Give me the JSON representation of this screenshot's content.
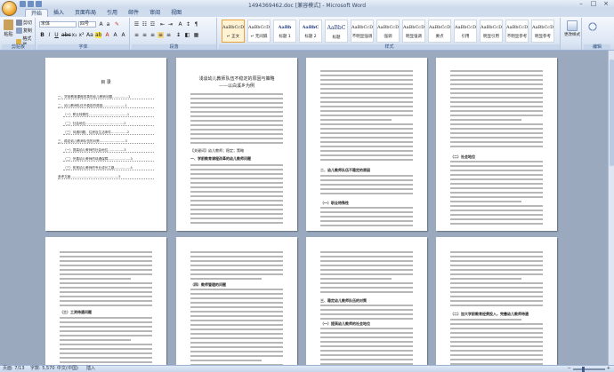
{
  "window": {
    "title": "1494369462.doc [兼容模式] - Microsoft Word"
  },
  "tabs": [
    "开始",
    "插入",
    "页面布局",
    "引用",
    "邮件",
    "审阅",
    "视图"
  ],
  "active_tab": "开始",
  "clipboard": {
    "paste": "粘贴",
    "cut": "剪切",
    "copy": "复制",
    "format_painter": "格式刷",
    "label": "剪贴板"
  },
  "font": {
    "name": "宋体",
    "size": "四号",
    "label": "字体"
  },
  "paragraph": {
    "label": "段落"
  },
  "styles": {
    "label": "样式",
    "items": [
      {
        "sample": "AaBbCcDc",
        "name": "↵ 正文",
        "selected": true
      },
      {
        "sample": "AaBbCcDc",
        "name": "↵ 无间隔",
        "selected": false
      },
      {
        "sample": "AaBb",
        "name": "标题 1",
        "selected": false
      },
      {
        "sample": "AaBbC",
        "name": "标题 2",
        "selected": false
      },
      {
        "sample": "AaBbC",
        "name": "标题",
        "selected": false
      },
      {
        "sample": "AaBbCcD",
        "name": "不明显强调",
        "selected": false
      },
      {
        "sample": "AaBbCcDc",
        "name": "强调",
        "selected": false
      },
      {
        "sample": "AaBbCcDc",
        "name": "明显强调",
        "selected": false
      },
      {
        "sample": "AaBbCcDc",
        "name": "要点",
        "selected": false
      },
      {
        "sample": "AaBbCcDc",
        "name": "引用",
        "selected": false
      },
      {
        "sample": "AaBbCcDc",
        "name": "明显引用",
        "selected": false
      },
      {
        "sample": "AaBbCcDc",
        "name": "不明显参考",
        "selected": false
      },
      {
        "sample": "AaBbCcDc",
        "name": "明显参考",
        "selected": false
      }
    ],
    "change_styles": "更改样式"
  },
  "editing": {
    "label": "编辑"
  },
  "toc_page": {
    "title": "目 录",
    "lines": [
      "一、学前教育课程改革的幼儿教师问题……………1",
      "二、幼儿教师队伍不稳定的原因…………………1",
      "（一）职业特殊性………………………………1",
      "（二）社会地位………………………………2",
      "（三）待遇问题、住房及生活条件……………2",
      "三、稳定幼儿教师队伍的对策……………………3",
      "（一）提高幼儿教师的社会地位……………3",
      "（二）完善幼儿教师的待遇保障…………………3",
      "（三）拓宽幼儿教师的专业成长之路……………4",
      "参考文献………………………………………5"
    ]
  },
  "main_page": {
    "title": "浅谈幼儿教师队伍不稳定的原因与策略",
    "subtitle": "——以白溪乡为例",
    "keywords": "【关键词】幼儿教师；稳定；策略",
    "heading1": "一、学前教育课程改革的幼儿教师问题"
  },
  "page3": {
    "heading": "二、幼儿教师队伍不稳定的原因",
    "subheading": "（一）职业特殊性"
  },
  "page4": {
    "heading": "（二）社会地位"
  },
  "page5": {
    "heading": "（三）工资待遇问题"
  },
  "page6": {
    "heading": "（四）教师管理的问题"
  },
  "page7": {
    "heading": "三、稳定幼儿教师队伍的对策",
    "subheading": "（一）提高幼儿教师的社会地位"
  },
  "page8": {
    "heading": "（二）加大学前教育经费投入，完善幼儿教师待遇"
  },
  "status": {
    "page": "页面: 7/13",
    "words": "字数: 5,570",
    "language": "中文(中国)",
    "mode": "插入"
  }
}
